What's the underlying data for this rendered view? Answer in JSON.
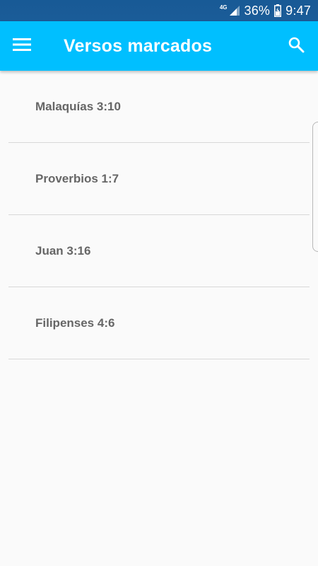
{
  "status_bar": {
    "network": "4G",
    "battery": "36%",
    "time": "9:47"
  },
  "app_bar": {
    "title": "Versos marcados",
    "menu_icon": "hamburger-menu-icon",
    "search_icon": "search-icon"
  },
  "verses": [
    {
      "label": "Malaquías 3:10"
    },
    {
      "label": "Proverbios 1:7"
    },
    {
      "label": "Juan 3:16"
    },
    {
      "label": "Filipenses 4:6"
    }
  ],
  "colors": {
    "status_bar": "#185a96",
    "app_bar": "#00bfff",
    "background": "#fafafa",
    "list_text": "#666666",
    "divider": "#d8d8d8"
  }
}
